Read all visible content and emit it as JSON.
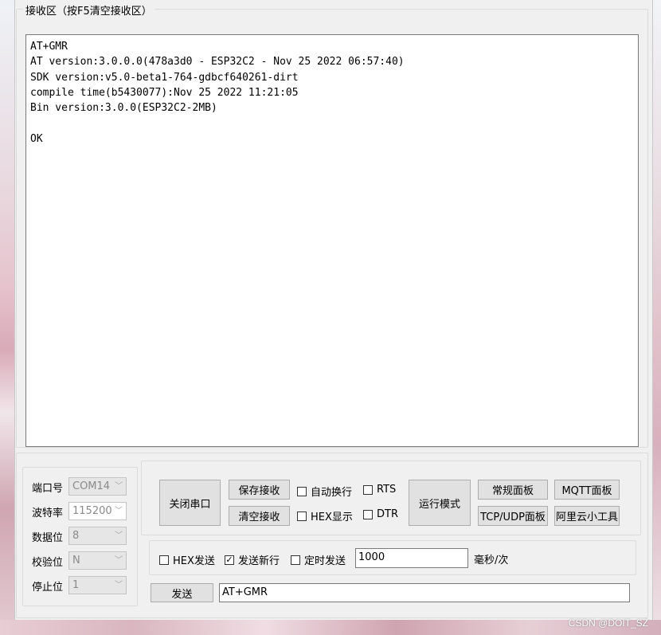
{
  "receive": {
    "group_title": "接收区（按F5清空接收区）",
    "lines": [
      "AT+GMR",
      "AT version:3.0.0.0(478a3d0 - ESP32C2 - Nov 25 2022 06:57:40)",
      "SDK version:v5.0-beta1-764-gdbcf640261-dirt",
      "compile time(b5430077):Nov 25 2022 11:21:05",
      "Bin version:3.0.0(ESP32C2-2MB)",
      "",
      "OK"
    ]
  },
  "port_settings": {
    "port_label": "端口号",
    "port_value": "COM14",
    "baud_label": "波特率",
    "baud_value": "115200",
    "databits_label": "数据位",
    "databits_value": "8",
    "parity_label": "校验位",
    "parity_value": "N",
    "stopbits_label": "停止位",
    "stopbits_value": "1"
  },
  "controls": {
    "close_port": "关闭串口",
    "save_receive": "保存接收",
    "clear_receive": "清空接收",
    "auto_wrap": "自动换行",
    "hex_display": "HEX显示",
    "rts": "RTS",
    "dtr": "DTR",
    "run_mode": "运行模式",
    "normal_panel": "常规面板",
    "mqtt_panel": "MQTT面板",
    "tcpudp_panel": "TCP/UDP面板",
    "aliyun_tool": "阿里云小工具"
  },
  "send": {
    "hex_send": "HEX发送",
    "send_newline": "发送新行",
    "send_newline_checked": true,
    "timed_send": "定时发送",
    "interval_value": "1000",
    "interval_unit": "毫秒/次",
    "send_button": "发送",
    "send_text": "AT+GMR"
  },
  "watermark": "CSDN @DOIT_SZ"
}
